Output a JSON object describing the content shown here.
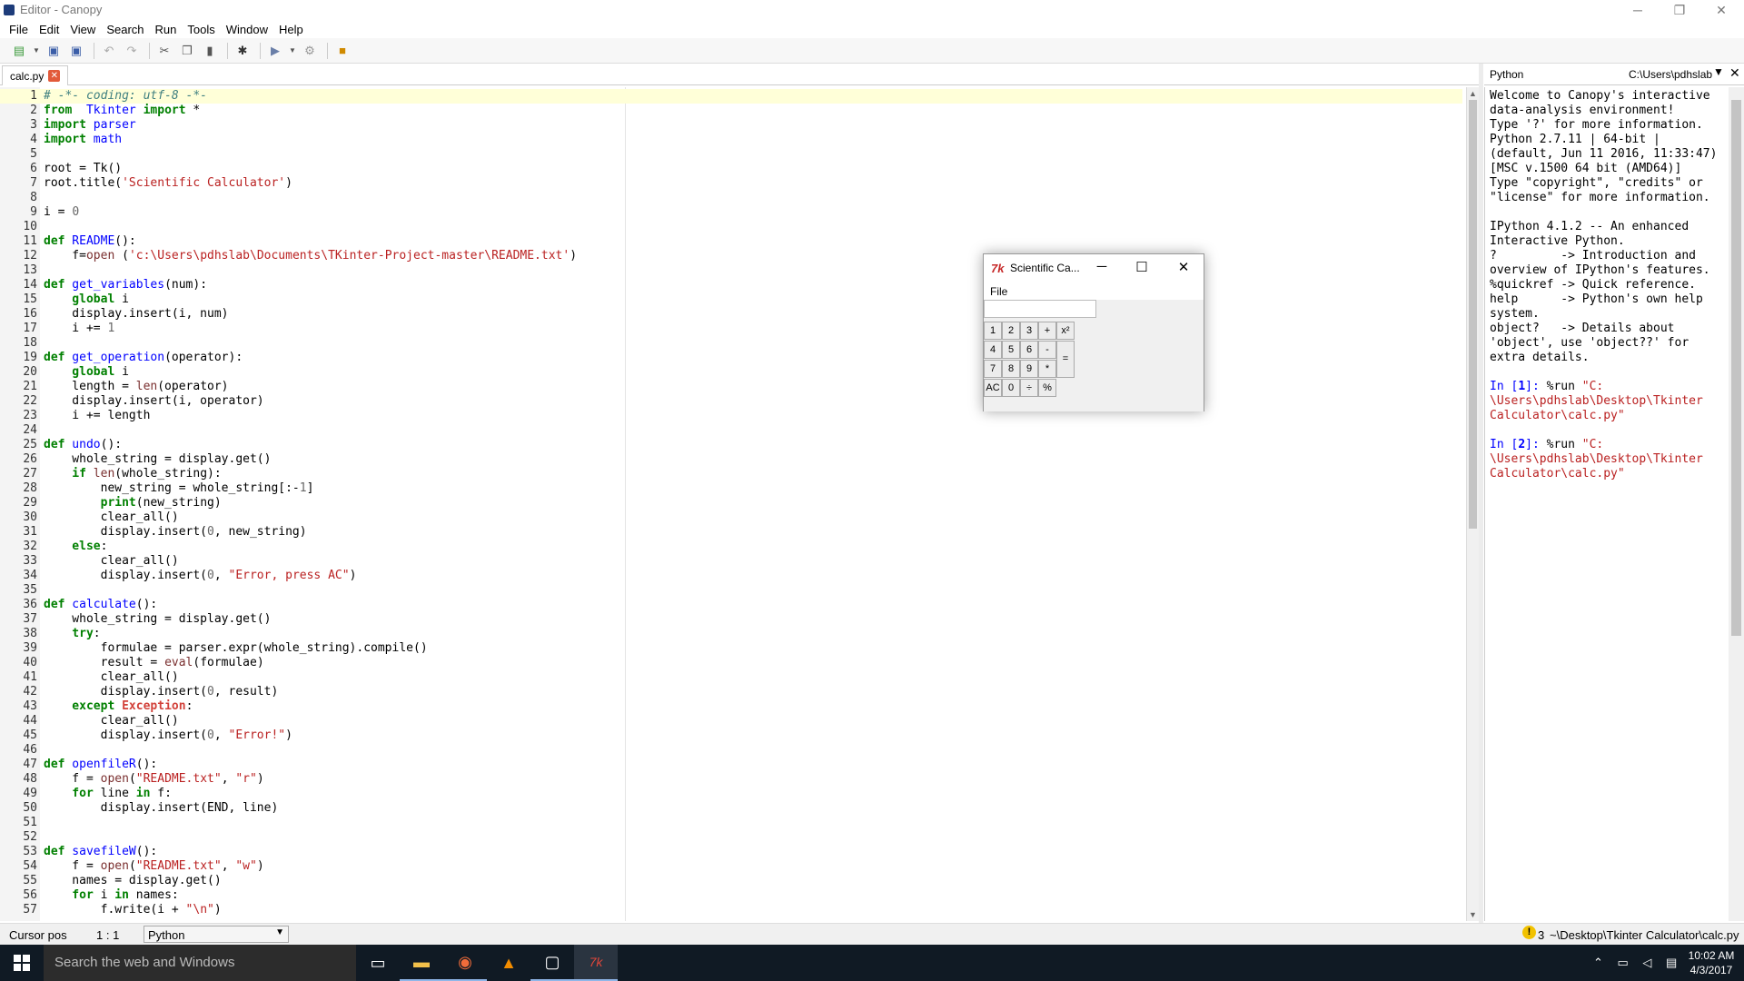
{
  "window": {
    "title": "Editor - Canopy",
    "minimize": "─",
    "restore": "❐",
    "close": "✕"
  },
  "menu": [
    "File",
    "Edit",
    "View",
    "Search",
    "Run",
    "Tools",
    "Window",
    "Help"
  ],
  "editor": {
    "tab_label": "calc.py",
    "lines": [
      [
        [
          "cmt",
          "# -*- coding: utf-8 -*-"
        ]
      ],
      [
        [
          "kw",
          "from"
        ],
        [
          "",
          "  "
        ],
        [
          "fn",
          "Tkinter"
        ],
        [
          "",
          ""
        ],
        [
          "kw",
          " import"
        ],
        [
          "",
          " *"
        ]
      ],
      [
        [
          "kw",
          "import"
        ],
        [
          "fn",
          " parser"
        ]
      ],
      [
        [
          "kw",
          "import"
        ],
        [
          "fn",
          " math"
        ]
      ],
      [],
      [
        [
          "",
          "root = Tk()"
        ]
      ],
      [
        [
          "",
          "root.title("
        ],
        [
          "str",
          "'Scientific Calculator'"
        ],
        [
          "",
          ")"
        ]
      ],
      [],
      [
        [
          "",
          "i = "
        ],
        [
          "num",
          "0"
        ]
      ],
      [],
      [
        [
          "kw",
          "def"
        ],
        [
          "fn",
          " README"
        ],
        [
          "",
          "():"
        ]
      ],
      [
        [
          "",
          "    f="
        ],
        [
          "bi",
          "open"
        ],
        [
          "",
          " ("
        ],
        [
          "str",
          "'c:\\Users\\pdhslab\\Documents\\TKinter-Project-master\\README.txt'"
        ],
        [
          "",
          ")"
        ]
      ],
      [],
      [
        [
          "kw",
          "def"
        ],
        [
          "fn",
          " get_variables"
        ],
        [
          "",
          "(num):"
        ]
      ],
      [
        [
          "kw",
          "    global"
        ],
        [
          "",
          " i"
        ]
      ],
      [
        [
          "",
          "    display.insert(i, num)"
        ]
      ],
      [
        [
          "",
          "    i += "
        ],
        [
          "num",
          "1"
        ]
      ],
      [],
      [
        [
          "kw",
          "def"
        ],
        [
          "fn",
          " get_operation"
        ],
        [
          "",
          "(operator):"
        ]
      ],
      [
        [
          "kw",
          "    global"
        ],
        [
          "",
          " i"
        ]
      ],
      [
        [
          "",
          "    length = "
        ],
        [
          "bi",
          "len"
        ],
        [
          "",
          "(operator)"
        ]
      ],
      [
        [
          "",
          "    display.insert(i, operator)"
        ]
      ],
      [
        [
          "",
          "    i += length"
        ]
      ],
      [],
      [
        [
          "kw",
          "def"
        ],
        [
          "fn",
          " undo"
        ],
        [
          "",
          "():"
        ]
      ],
      [
        [
          "",
          "    whole_string = display.get()"
        ]
      ],
      [
        [
          "kw",
          "    if"
        ],
        [
          "bi",
          " len"
        ],
        [
          "",
          "(whole_string):"
        ]
      ],
      [
        [
          "",
          "        new_string = whole_string[:-"
        ],
        [
          "num",
          "1"
        ],
        [
          "",
          "]"
        ]
      ],
      [
        [
          "kw",
          "        print"
        ],
        [
          "",
          "(new_string)"
        ]
      ],
      [
        [
          "",
          "        clear_all()"
        ]
      ],
      [
        [
          "",
          "        display.insert("
        ],
        [
          "num",
          "0"
        ],
        [
          "",
          ", new_string)"
        ]
      ],
      [
        [
          "kw",
          "    else"
        ],
        [
          "",
          ":"
        ]
      ],
      [
        [
          "",
          "        clear_all()"
        ]
      ],
      [
        [
          "",
          "        display.insert("
        ],
        [
          "num",
          "0"
        ],
        [
          "",
          ", "
        ],
        [
          "str",
          "\"Error, press AC\""
        ],
        [
          "",
          ")"
        ]
      ],
      [],
      [
        [
          "kw",
          "def"
        ],
        [
          "fn",
          " calculate"
        ],
        [
          "",
          "():"
        ]
      ],
      [
        [
          "",
          "    whole_string = display.get()"
        ]
      ],
      [
        [
          "kw",
          "    try"
        ],
        [
          "",
          ":"
        ]
      ],
      [
        [
          "",
          "        formulae = parser.expr(whole_string).compile()"
        ]
      ],
      [
        [
          "",
          "        result = "
        ],
        [
          "bi",
          "eval"
        ],
        [
          "",
          "(formulae)"
        ]
      ],
      [
        [
          "",
          "        clear_all()"
        ]
      ],
      [
        [
          "",
          "        display.insert("
        ],
        [
          "num",
          "0"
        ],
        [
          "",
          ", result)"
        ]
      ],
      [
        [
          "kw",
          "    except"
        ],
        [
          "exc",
          " Exception"
        ],
        [
          "",
          ":"
        ]
      ],
      [
        [
          "",
          "        clear_all()"
        ]
      ],
      [
        [
          "",
          "        display.insert("
        ],
        [
          "num",
          "0"
        ],
        [
          "",
          ", "
        ],
        [
          "str",
          "\"Error!\""
        ],
        [
          "",
          ")"
        ]
      ],
      [],
      [
        [
          "kw",
          "def"
        ],
        [
          "fn",
          " openfileR"
        ],
        [
          "",
          "():"
        ]
      ],
      [
        [
          "",
          "    f = "
        ],
        [
          "bi",
          "open"
        ],
        [
          "",
          "("
        ],
        [
          "str",
          "\"README.txt\""
        ],
        [
          "",
          ", "
        ],
        [
          "str",
          "\"r\""
        ],
        [
          "",
          ")"
        ]
      ],
      [
        [
          "kw",
          "    for"
        ],
        [
          "",
          " line "
        ],
        [
          "kw",
          "in"
        ],
        [
          "",
          " f:"
        ]
      ],
      [
        [
          "",
          "        display.insert(END, line)"
        ]
      ],
      [],
      [],
      [
        [
          "kw",
          "def"
        ],
        [
          "fn",
          " savefileW"
        ],
        [
          "",
          "():"
        ]
      ],
      [
        [
          "",
          "    f = "
        ],
        [
          "bi",
          "open"
        ],
        [
          "",
          "("
        ],
        [
          "str",
          "\"README.txt\""
        ],
        [
          "",
          ", "
        ],
        [
          "str",
          "\"w\""
        ],
        [
          "",
          ")"
        ]
      ],
      [
        [
          "",
          "    names = display.get()"
        ]
      ],
      [
        [
          "kw",
          "    for"
        ],
        [
          "",
          " i "
        ],
        [
          "kw",
          "in"
        ],
        [
          "",
          " names:"
        ]
      ],
      [
        [
          "",
          "        f.write(i + "
        ],
        [
          "str",
          "\"\\n\""
        ],
        [
          "",
          ")"
        ]
      ]
    ]
  },
  "python_pane": {
    "label": "Python",
    "path": "C:\\Users\\pdhslab",
    "console": [
      [
        [
          "",
          "Welcome to Canopy's interactive"
        ]
      ],
      [
        [
          "",
          "data-analysis environment!"
        ]
      ],
      [
        [
          "",
          "Type '?' for more information."
        ]
      ],
      [
        [
          "",
          "Python 2.7.11 | 64-bit |"
        ]
      ],
      [
        [
          "",
          "(default, Jun 11 2016, 11:33:47)"
        ]
      ],
      [
        [
          "",
          "[MSC v.1500 64 bit (AMD64)]"
        ]
      ],
      [
        [
          "",
          "Type \"copyright\", \"credits\" or"
        ]
      ],
      [
        [
          "",
          "\"license\" for more information."
        ]
      ],
      [],
      [
        [
          "",
          "IPython 4.1.2 -- An enhanced"
        ]
      ],
      [
        [
          "",
          "Interactive Python."
        ]
      ],
      [
        [
          "",
          "?         -> Introduction and"
        ]
      ],
      [
        [
          "",
          "overview of IPython's features."
        ]
      ],
      [
        [
          "",
          "%quickref -> Quick reference."
        ]
      ],
      [
        [
          "",
          "help      -> Python's own help"
        ]
      ],
      [
        [
          "",
          "system."
        ]
      ],
      [
        [
          "",
          "object?   -> Details about"
        ]
      ],
      [
        [
          "",
          "'object', use 'object??' for"
        ]
      ],
      [
        [
          "",
          "extra details."
        ]
      ],
      [],
      [
        [
          "prompt",
          "In ["
        ],
        [
          "promptb",
          "1"
        ],
        [
          "prompt",
          "]: "
        ],
        [
          "",
          "%run "
        ],
        [
          "run",
          "\"C:"
        ]
      ],
      [
        [
          "run",
          "\\Users\\pdhslab\\Desktop\\Tkinter"
        ]
      ],
      [
        [
          "run",
          "Calculator\\calc.py\""
        ]
      ],
      [],
      [
        [
          "prompt",
          "In ["
        ],
        [
          "promptb",
          "2"
        ],
        [
          "prompt",
          "]: "
        ],
        [
          "",
          "%run "
        ],
        [
          "run",
          "\"C:"
        ]
      ],
      [
        [
          "run",
          "\\Users\\pdhslab\\Desktop\\Tkinter"
        ]
      ],
      [
        [
          "run",
          "Calculator\\calc.py\""
        ]
      ]
    ]
  },
  "status": {
    "cursor_label": "Cursor pos",
    "cursor_value": "1 : 1",
    "language": "Python",
    "warnings": "3",
    "file_path": "~\\Desktop\\Tkinter Calculator\\calc.py"
  },
  "calculator": {
    "title": "Scientific Ca...",
    "icon": "7k",
    "menu": "File",
    "keys": [
      [
        "1",
        "2",
        "3",
        "+",
        "x²"
      ],
      [
        "4",
        "5",
        "6",
        "-"
      ],
      [
        "7",
        "8",
        "9",
        "*",
        "="
      ],
      [
        "AC",
        "0",
        "÷",
        "%"
      ]
    ]
  },
  "taskbar": {
    "search_placeholder": "Search the web and Windows",
    "time": "10:02 AM",
    "date": "4/3/2017"
  }
}
